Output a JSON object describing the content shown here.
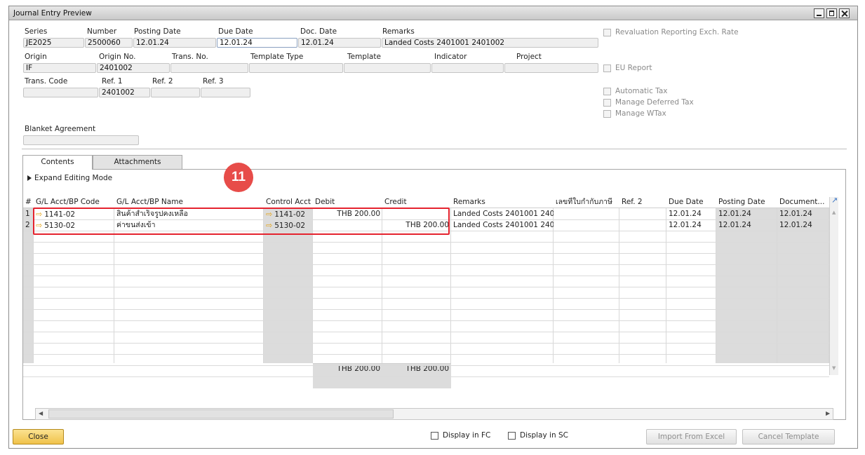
{
  "window": {
    "title": "Journal Entry Preview"
  },
  "header": {
    "series": {
      "label": "Series",
      "value": "JE2025"
    },
    "number": {
      "label": "Number",
      "value": "2500060"
    },
    "posting_date": {
      "label": "Posting Date",
      "value": "12.01.24"
    },
    "due_date": {
      "label": "Due Date",
      "value": "12.01.24"
    },
    "doc_date": {
      "label": "Doc. Date",
      "value": "12.01.24"
    },
    "remarks": {
      "label": "Remarks",
      "value": "Landed Costs 2401001 2401002"
    },
    "origin": {
      "label": "Origin",
      "value": "IF"
    },
    "origin_no": {
      "label": "Origin No.",
      "value": "2401002"
    },
    "trans_no": {
      "label": "Trans. No.",
      "value": ""
    },
    "template_type": {
      "label": "Template Type",
      "value": ""
    },
    "template": {
      "label": "Template",
      "value": ""
    },
    "indicator": {
      "label": "Indicator",
      "value": ""
    },
    "project": {
      "label": "Project",
      "value": ""
    },
    "trans_code": {
      "label": "Trans. Code",
      "value": ""
    },
    "ref1": {
      "label": "Ref. 1",
      "value": "2401002"
    },
    "ref2": {
      "label": "Ref. 2",
      "value": ""
    },
    "ref3": {
      "label": "Ref. 3",
      "value": ""
    },
    "blanket_agreement": {
      "label": "Blanket Agreement",
      "value": ""
    }
  },
  "options": {
    "revaluation": "Revaluation Reporting Exch. Rate",
    "eu_report": "EU Report",
    "automatic_tax": "Automatic Tax",
    "manage_deferred_tax": "Manage Deferred Tax",
    "manage_wtax": "Manage WTax"
  },
  "tabs": {
    "contents": "Contents",
    "attachments": "Attachments"
  },
  "expand_editing_mode": "Expand Editing Mode",
  "annotation_badge": "11",
  "grid": {
    "columns": [
      "#",
      "G/L Acct/BP Code",
      "G/L Acct/BP Name",
      "Control Acct",
      "Debit",
      "Credit",
      "Remarks",
      "เลขที่ใบกำกับภาษี",
      "Ref. 2",
      "Due Date",
      "Posting Date",
      "Document..."
    ],
    "rows": [
      {
        "num": "1",
        "code": "1141-02",
        "name": "สินค้าสำเร็จรูปคงเหลือ",
        "control": "1141-02",
        "debit": "THB 200.00",
        "credit": "",
        "remarks": "Landed Costs 2401001 2401",
        "tax_no": "",
        "ref2": "",
        "due": "12.01.24",
        "posting": "12.01.24",
        "doc": "12.01.24"
      },
      {
        "num": "2",
        "code": "5130-02",
        "name": "ค่าขนส่งเข้า",
        "control": "5130-02",
        "debit": "",
        "credit": "THB 200.00",
        "remarks": "Landed Costs 2401001 2401",
        "tax_no": "",
        "ref2": "",
        "due": "12.01.24",
        "posting": "12.01.24",
        "doc": "12.01.24"
      }
    ],
    "totals": {
      "debit": "THB 200.00",
      "credit": "THB 200.00"
    }
  },
  "footer": {
    "close": "Close",
    "display_fc": "Display in FC",
    "display_sc": "Display in SC",
    "import_excel": "Import From Excel",
    "cancel_template": "Cancel Template"
  },
  "colors": {
    "highlight": "#e5232e",
    "badge": "#e74c49",
    "close_button": "#f0c24a",
    "arrow": "#e6a417"
  }
}
